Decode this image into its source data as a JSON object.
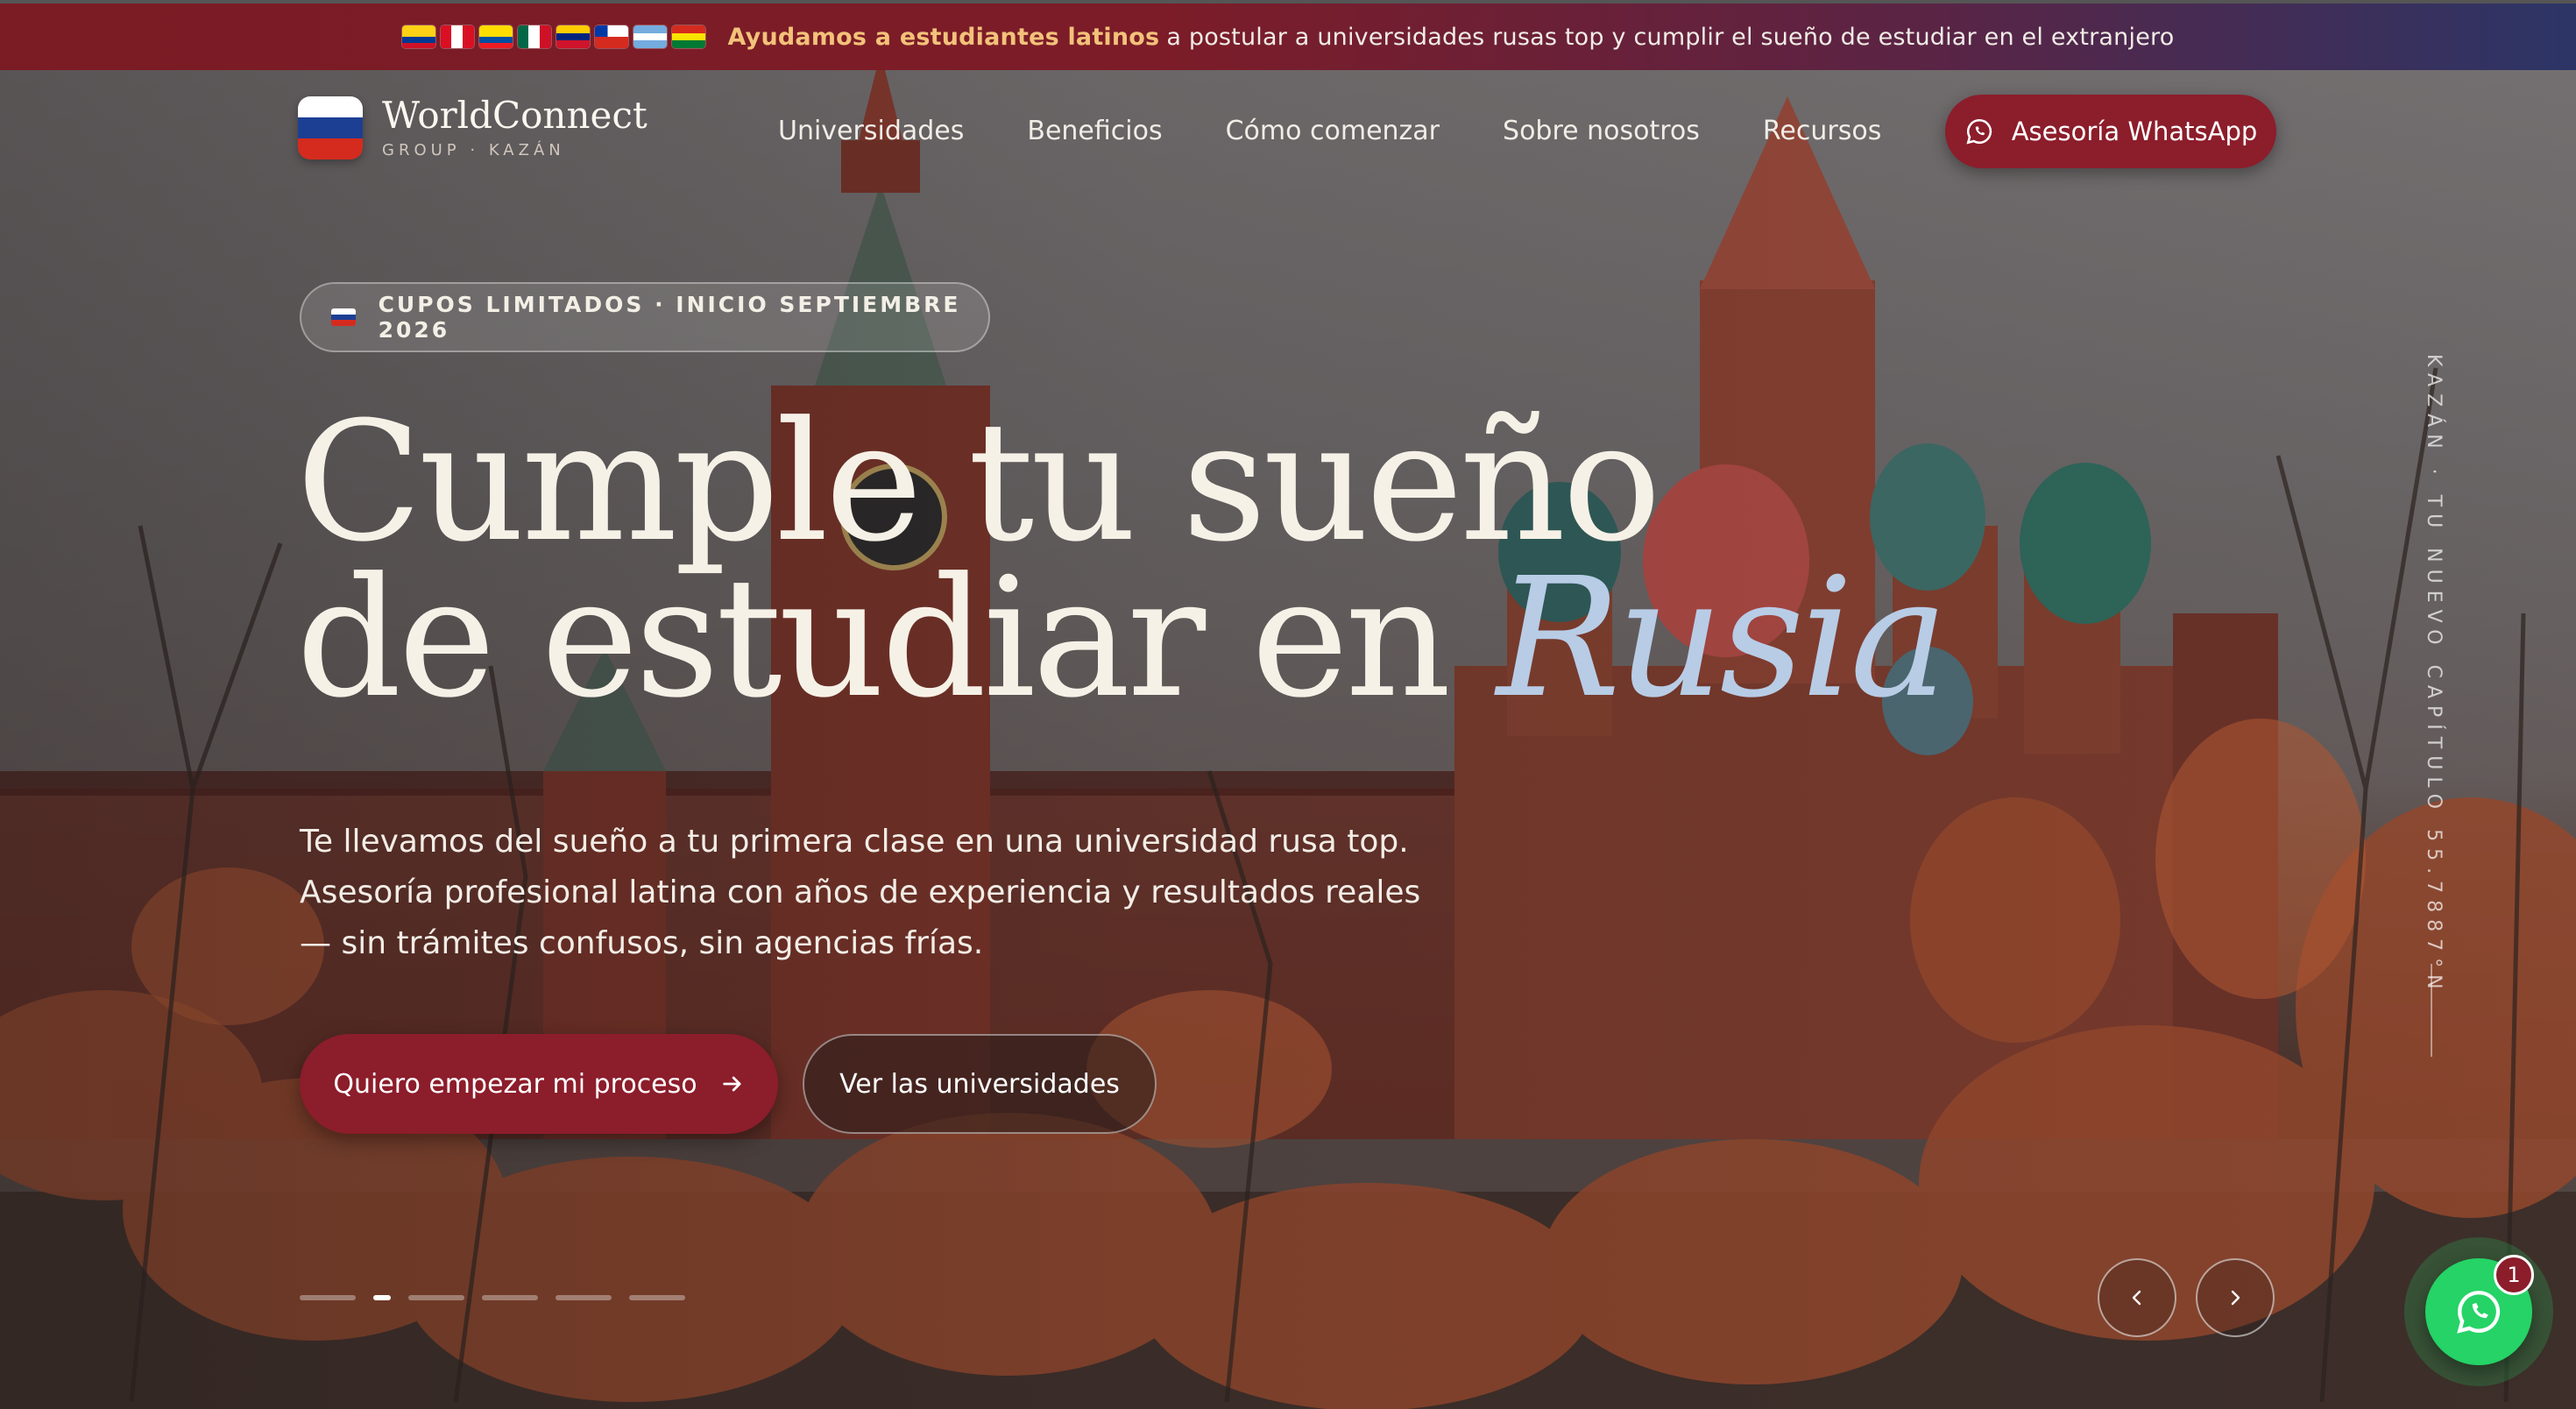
{
  "announcement": {
    "flags": [
      "colombia",
      "peru",
      "ecuador",
      "mexico",
      "venezuela",
      "chile",
      "argentina",
      "bolivia"
    ],
    "highlight": "Ayudamos a estudiantes latinos",
    "text": "a postular a universidades rusas top y cumplir el sueño de estudiar en el extranjero"
  },
  "brand": {
    "name": "WorldConnect",
    "subtitle": "GROUP · KAZÁN"
  },
  "nav": {
    "items": [
      "Universidades",
      "Beneficios",
      "Cómo comenzar",
      "Sobre nosotros",
      "Recursos"
    ]
  },
  "header_cta": {
    "label": "Asesoría WhatsApp",
    "icon": "whatsapp-icon"
  },
  "hero": {
    "badge": "CUPOS LIMITADOS · INICIO SEPTIEMBRE 2026",
    "headline_line1": "Cumple tu sueño",
    "headline_line2_prefix": "de estudiar en",
    "headline_accent": "Rusia",
    "subtext": "Te llevamos del sueño a tu primera clase en una universidad rusa top. Asesoría profesional latina con años de experiencia y resultados reales — sin trámites confusos, sin agencias frías.",
    "primary_cta": "Quiero empezar mi proceso",
    "secondary_cta": "Ver las universidades"
  },
  "side_caption": {
    "line1": "KAZÁN · TU NUEVO CAPÍTULO",
    "line2": "55.7887°N"
  },
  "slider": {
    "total_slides": 6,
    "active_index": 1
  },
  "floating_whatsapp": {
    "badge_count": "1"
  },
  "colors": {
    "primary": "#8c1d2b",
    "accent_text": "#b8cce6",
    "highlight": "#f3c27a",
    "whatsapp": "#25d366"
  }
}
